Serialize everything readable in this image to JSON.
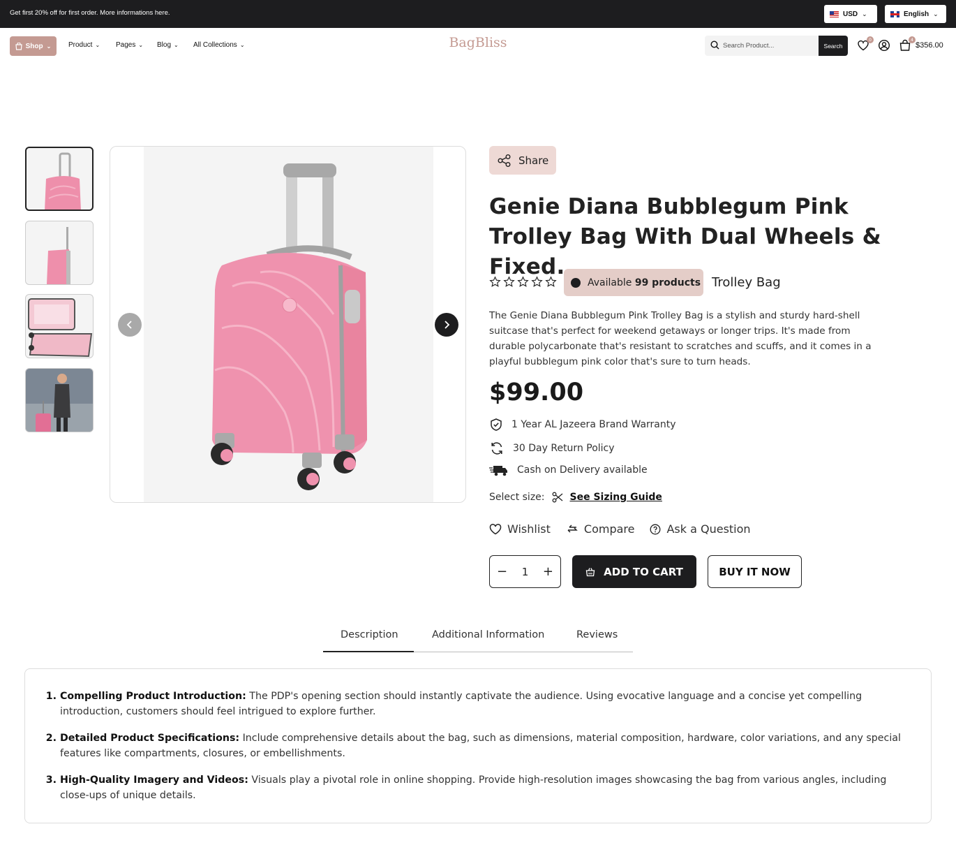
{
  "topbar": {
    "promo": "Get first 20% off for first order. More informations here.",
    "currency": "USD",
    "language": "English"
  },
  "nav": {
    "shop": "Shop",
    "items": [
      "Product",
      "Pages",
      "Blog",
      "All Collections"
    ],
    "logo": "BagBliss",
    "search_placeholder": "Search Product...",
    "search_button": "Search",
    "wishlist_count": "0",
    "cart_count": "4",
    "cart_total": "$356.00"
  },
  "product": {
    "share": "Share",
    "title": "Genie Diana Bubblegum Pink Trolley Bag With Dual Wheels & Fixed...",
    "rating": 0,
    "rating_max": 5,
    "availability_prefix": "Available",
    "availability_count": "99 products",
    "category": "Trolley Bag",
    "description": "The Genie Diana Bubblegum Pink Trolley Bag is a stylish and sturdy hard-shell suitcase that's perfect for weekend getaways or longer trips. It's made from durable polycarbonate that's resistant to scratches and scuffs, and it comes in a playful bubblegum pink color that's sure to turn heads.",
    "price": "$99.00",
    "features": [
      "1 Year AL Jazeera Brand Warranty",
      "30 Day Return Policy",
      "Cash on Delivery available"
    ],
    "select_size": "Select size:",
    "sizing_guide": "See Sizing Guide",
    "wishlist": "Wishlist",
    "compare": "Compare",
    "ask": "Ask a Question",
    "quantity": "1",
    "add_to_cart": "ADD TO CART",
    "buy_now": "BUY IT NOW",
    "colors": {
      "accent": "#c49a92",
      "dark": "#1d1d1f",
      "bag": "#ee8fab"
    }
  },
  "tabs": {
    "items": [
      "Description",
      "Additional Information",
      "Reviews"
    ],
    "active": "Description"
  },
  "description_list": [
    {
      "title": "Compelling Product Introduction:",
      "text": " The PDP's opening section should instantly captivate the audience. Using evocative language and a concise yet compelling introduction, customers should feel intrigued to explore further."
    },
    {
      "title": "Detailed Product Specifications:",
      "text": " Include comprehensive details about the bag, such as dimensions, material composition, hardware, color variations, and any special features like compartments, closures, or embellishments."
    },
    {
      "title": "High-Quality Imagery and Videos:",
      "text": " Visuals play a pivotal role in online shopping. Provide high-resolution images showcasing the bag from various angles, including close-ups of unique details."
    }
  ]
}
